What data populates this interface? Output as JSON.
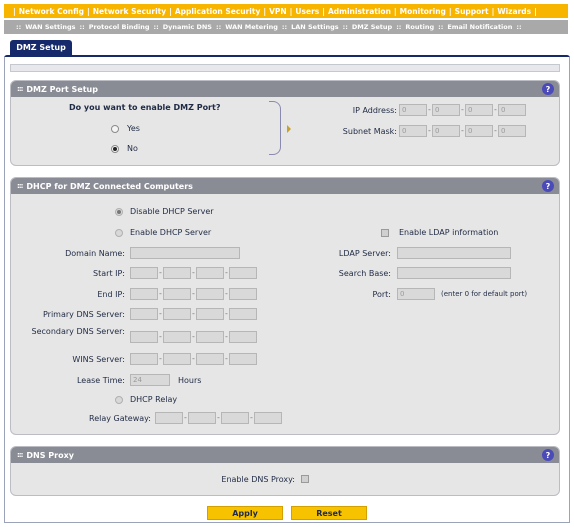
{
  "topnav": {
    "items": [
      "Network Config",
      "Network Security",
      "Application Security",
      "VPN",
      "Users",
      "Administration",
      "Monitoring",
      "Support",
      "Wizards"
    ]
  },
  "subnav": {
    "items": [
      "WAN Settings",
      "Protocol Binding",
      "Dynamic DNS",
      "WAN Metering",
      "LAN Settings",
      "DMZ Setup",
      "Routing",
      "Email Notification"
    ]
  },
  "tab": {
    "label": "DMZ Setup"
  },
  "dmz_port": {
    "title": "DMZ Port Setup",
    "question": "Do you want to enable DMZ Port?",
    "yes_label": "Yes",
    "no_label": "No",
    "ip_label": "IP Address:",
    "mask_label": "Subnet Mask:",
    "ip": [
      "0",
      "0",
      "0",
      "0"
    ],
    "mask": [
      "0",
      "0",
      "0",
      "0"
    ],
    "selected": "No"
  },
  "dhcp": {
    "title": "DHCP for DMZ Connected Computers",
    "disable_label": "Disable DHCP Server",
    "enable_label": "Enable DHCP Server",
    "ldap_enable_label": "Enable LDAP information",
    "domain_label": "Domain Name:",
    "start_ip_label": "Start IP:",
    "end_ip_label": "End IP:",
    "primary_dns_label": "Primary DNS Server:",
    "secondary_dns_label": "Secondary DNS Server:",
    "wins_label": "WINS Server:",
    "lease_label": "Lease Time:",
    "lease_value": "24",
    "lease_unit": "Hours",
    "relay_label": "DHCP Relay",
    "relay_gateway_label": "Relay Gateway:",
    "ldap_server_label": "LDAP Server:",
    "search_base_label": "Search Base:",
    "port_label": "Port:",
    "port_value": "0",
    "port_hint": "(enter 0 for default port)"
  },
  "dns_proxy": {
    "title": "DNS Proxy",
    "enable_label": "Enable DNS Proxy:"
  },
  "buttons": {
    "apply": "Apply",
    "reset": "Reset"
  },
  "colors": {
    "accent": "#f7b500",
    "tab": "#162a6b",
    "section_header": "#8a8c95",
    "help": "#4a4bb8"
  }
}
